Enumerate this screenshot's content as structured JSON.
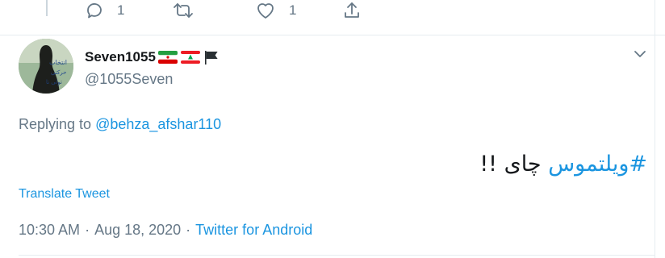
{
  "actions": {
    "reply_count": "1",
    "like_count": "1"
  },
  "tweet": {
    "display_name": "Seven1055",
    "handle": "@1055Seven",
    "replying_prefix": "Replying to",
    "replying_handle": "@behza_afshar110",
    "hashtag": "#ویلتموس",
    "text_rest": "چای !!",
    "translate_label": "Translate Tweet",
    "time": "10:30 AM",
    "separator": "·",
    "date": "Aug 18, 2020",
    "source": "Twitter for Android"
  },
  "icons": {
    "reply": "reply-icon",
    "retweet": "retweet-icon",
    "like": "heart-icon",
    "share": "share-icon",
    "caret": "chevron-down-icon",
    "flags": [
      "iran-flag-icon",
      "lebanon-flag-icon",
      "black-flag-icon"
    ]
  },
  "colors": {
    "link": "#1b95e0",
    "secondary_text": "#657786",
    "primary_text": "#14171a",
    "divider": "#e6ecf0"
  },
  "avatar": {
    "overlay_text_lines": [
      "انتخاب",
      "حرکتی",
      "تولی تا"
    ]
  }
}
